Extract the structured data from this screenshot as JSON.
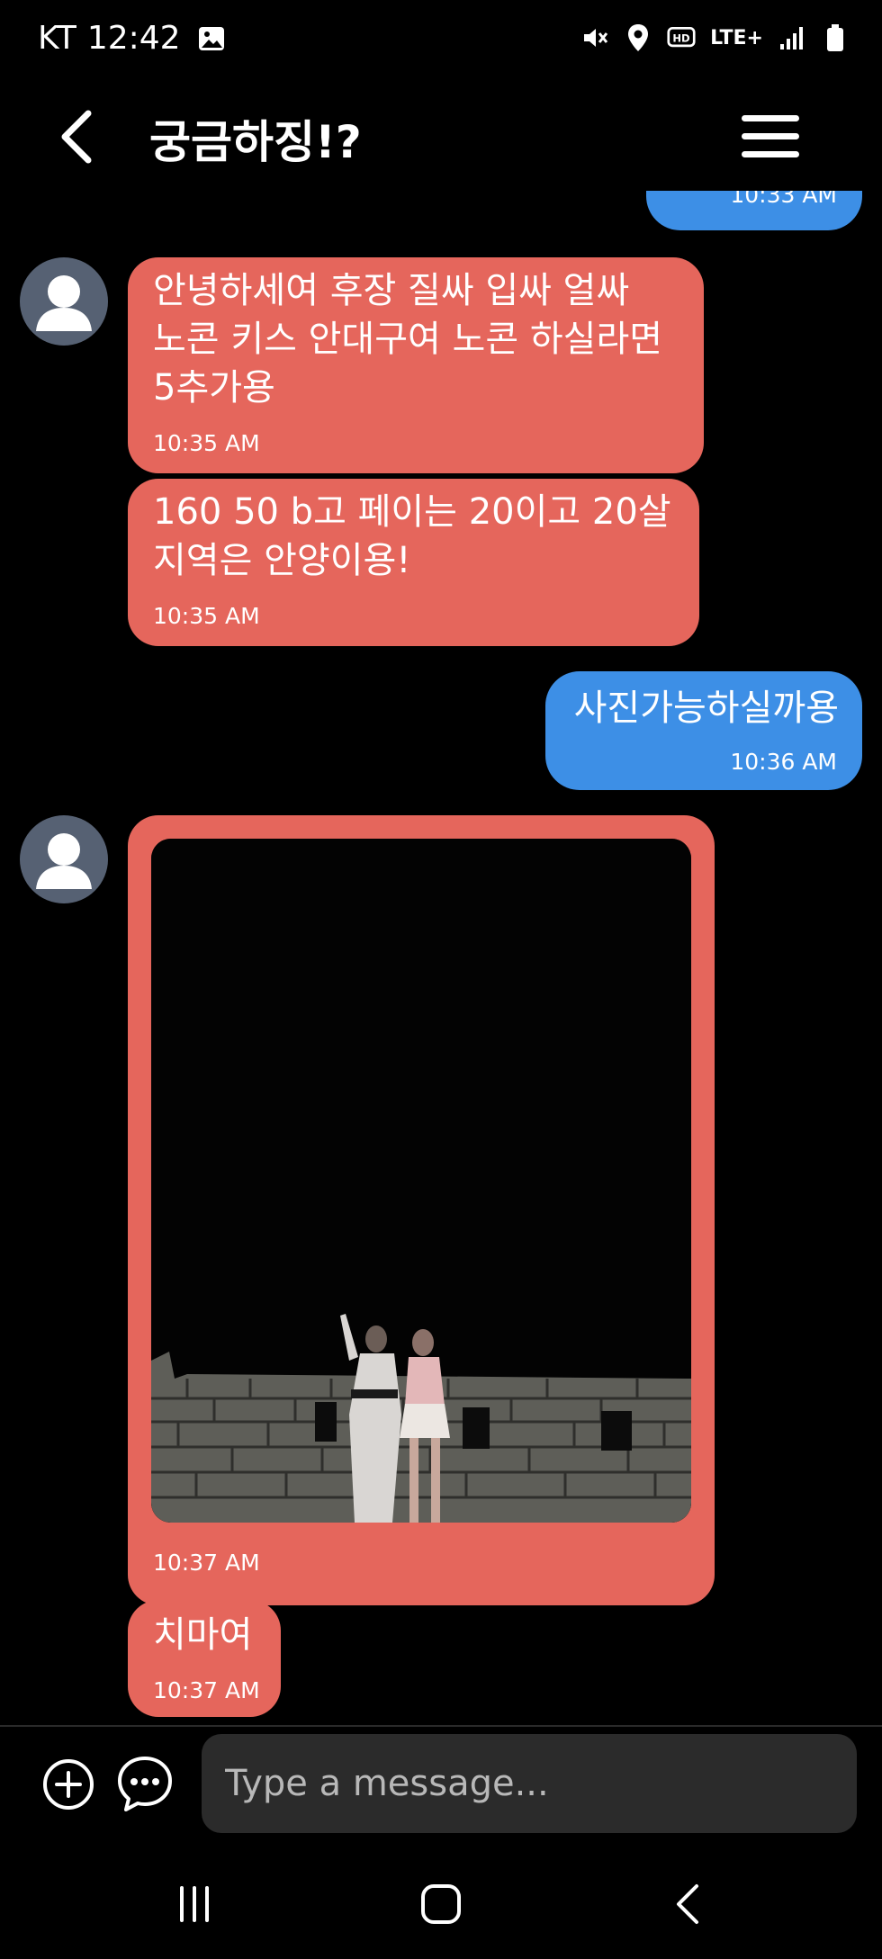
{
  "status_bar": {
    "carrier": "KT",
    "time": "12:42",
    "network": "LTE+",
    "icons": [
      "gallery-icon",
      "vibrate-mute-icon",
      "location-icon",
      "hd-voice-icon",
      "lte-icon",
      "signal-icon",
      "battery-icon"
    ]
  },
  "header": {
    "title": "궁금하징!?",
    "back_icon": "chevron-left-icon",
    "menu_icon": "hamburger-menu-icon"
  },
  "messages": [
    {
      "direction": "out",
      "text": "",
      "time": "10:33 AM",
      "partial": true
    },
    {
      "direction": "in",
      "lines": [
        "안녕하세여 후장 질싸 입싸 얼싸",
        "노콘 키스  안대구여 노콘 하실라면",
        "5추가용"
      ],
      "time": "10:35 AM"
    },
    {
      "direction": "in",
      "lines": [
        "160 50  b고 페이는 20이고 20살",
        "지역은 안양이용!"
      ],
      "time": "10:35 AM"
    },
    {
      "direction": "out",
      "text": "사진가능하실까용",
      "time": "10:36 AM"
    },
    {
      "direction": "in",
      "type": "image",
      "time": "10:37 AM"
    },
    {
      "direction": "in",
      "text": "치마여",
      "time": "10:37 AM"
    }
  ],
  "composer": {
    "placeholder": "Type a message...",
    "plus_icon": "add-circle-icon",
    "emoji_icon": "chat-bubble-icon"
  },
  "nav_bar": {
    "icons": [
      "recent-apps-icon",
      "home-icon",
      "back-icon"
    ]
  },
  "colors": {
    "outgoing_bubble": "#3d8fe6",
    "incoming_bubble": "#e5665c",
    "background": "#000000",
    "input_background": "#2b2b2b"
  }
}
